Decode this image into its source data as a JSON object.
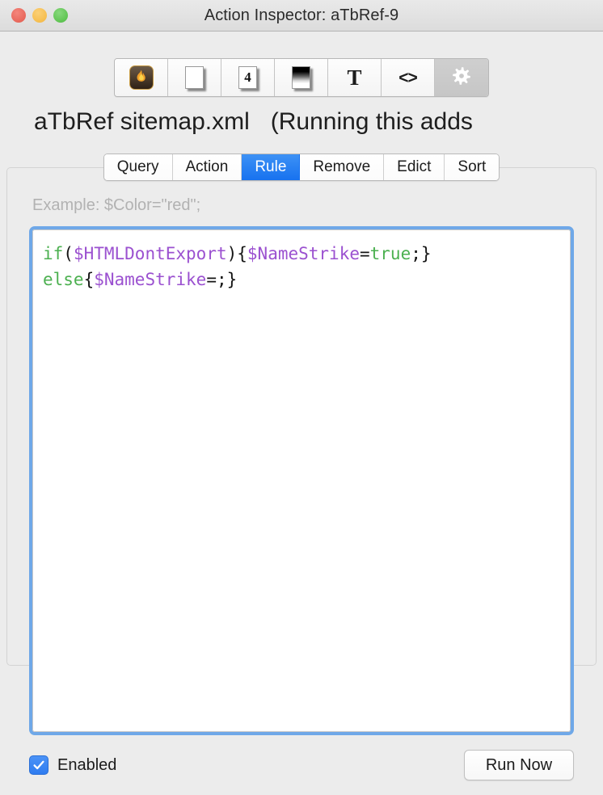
{
  "window": {
    "title": "Action Inspector: aTbRef-9",
    "traffic_lights": [
      {
        "name": "close",
        "color": "#ED6A5E"
      },
      {
        "name": "minimize",
        "color": "#F5BD4F"
      },
      {
        "name": "zoom",
        "color": "#61C454"
      }
    ]
  },
  "toolbar": {
    "items": [
      {
        "icon": "flame-icon",
        "label": "Tinderbox",
        "selected": false
      },
      {
        "icon": "blank-document-icon",
        "label": "Document",
        "selected": false
      },
      {
        "icon": "numbered-document-icon",
        "label": "4",
        "selected": false
      },
      {
        "icon": "gradient-document-icon",
        "label": "Appearance",
        "selected": false
      },
      {
        "icon": "text-t-icon",
        "label": "T",
        "selected": false
      },
      {
        "icon": "code-brackets-icon",
        "label": "<>",
        "selected": false
      },
      {
        "icon": "gear-icon",
        "label": "Action",
        "selected": true
      }
    ]
  },
  "header": {
    "document_name": "aTbRef sitemap.xml",
    "note": "(Running this adds"
  },
  "tabs": {
    "items": [
      {
        "label": "Query",
        "active": false
      },
      {
        "label": "Action",
        "active": false
      },
      {
        "label": "Rule",
        "active": true
      },
      {
        "label": "Remove",
        "active": false
      },
      {
        "label": "Edict",
        "active": false
      },
      {
        "label": "Sort",
        "active": false
      }
    ],
    "selected": "Rule"
  },
  "hint": {
    "text": "Example: $Color=\"red\";"
  },
  "editor": {
    "focused": true,
    "focus_ring_color": "#6FA8E8",
    "plain_text": "if($HTMLDontExport){$NameStrike=true;}\nelse{$NameStrike=;}",
    "lines": [
      [
        {
          "t": "if",
          "c": "kw"
        },
        {
          "t": "(",
          "c": "pun"
        },
        {
          "t": "$HTMLDontExport",
          "c": "var"
        },
        {
          "t": "){",
          "c": "pun"
        },
        {
          "t": "$NameStrike",
          "c": "var"
        },
        {
          "t": "=",
          "c": "pun"
        },
        {
          "t": "true",
          "c": "val"
        },
        {
          "t": ";}",
          "c": "pun"
        }
      ],
      [
        {
          "t": "else",
          "c": "kw"
        },
        {
          "t": "{",
          "c": "pun"
        },
        {
          "t": "$NameStrike",
          "c": "var"
        },
        {
          "t": "=;}",
          "c": "pun"
        }
      ]
    ],
    "colors": {
      "keyword": "#4CB050",
      "variable": "#9B51D0",
      "value": "#4CB050",
      "punctuation": "#141414"
    }
  },
  "footer": {
    "enabled_label": "Enabled",
    "enabled_checked": true,
    "run_button_label": "Run Now",
    "accent_color": "#2F7CF0"
  }
}
